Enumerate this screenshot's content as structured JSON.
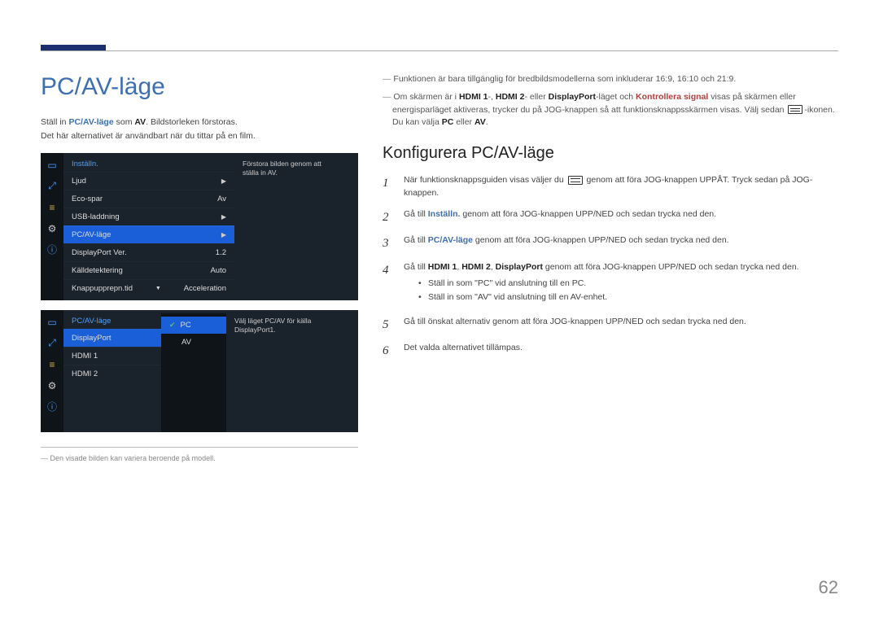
{
  "page_number": "62",
  "left": {
    "title": "PC/AV-läge",
    "para1_pre": "Ställ in ",
    "para1_hl": "PC/AV-läge",
    "para1_mid": " som ",
    "para1_bold": "AV",
    "para1_post": ". Bildstorleken förstoras.",
    "para2": "Det här alternativet är användbart när du tittar på en film.",
    "footnote": "Den visade bilden kan variera beroende på modell."
  },
  "osd1": {
    "title": "Inställn.",
    "rows": [
      {
        "label": "Ljud",
        "value": "",
        "chev": true
      },
      {
        "label": "Eco-spar",
        "value": "Av"
      },
      {
        "label": "USB-laddning",
        "value": "",
        "chev": true
      },
      {
        "label": "PC/AV-läge",
        "value": "",
        "chev": true,
        "selected": true
      },
      {
        "label": "DisplayPort Ver.",
        "value": "1.2"
      },
      {
        "label": "Källdetektering",
        "value": "Auto"
      },
      {
        "label": "Knappupprepn.tid",
        "value": "Acceleration"
      }
    ],
    "desc": "Förstora bilden genom att ställa in AV."
  },
  "osd2": {
    "title": "PC/AV-läge",
    "rows": [
      {
        "label": "DisplayPort",
        "selected": true
      },
      {
        "label": "HDMI 1"
      },
      {
        "label": "HDMI 2"
      }
    ],
    "popup": [
      {
        "label": "PC",
        "selected": true,
        "check": true
      },
      {
        "label": "AV"
      }
    ],
    "desc": "Välj läget PC/AV för källa DisplayPort1."
  },
  "right": {
    "note1": "Funktionen är bara tillgänglig för bredbildsmodellerna som inkluderar 16:9, 16:10 och 21:9.",
    "note2_a": "Om skärmen är i ",
    "note2_h1": "HDMI 1",
    "note2_b": "-, ",
    "note2_h2": "HDMI 2",
    "note2_c": "- eller ",
    "note2_h3": "DisplayPort",
    "note2_d": "-läget och ",
    "note2_red": "Kontrollera signal",
    "note2_e": " visas på skärmen eller energisparläget aktiveras, trycker du på JOG-knappen så att funktionsknappsskärmen visas. Välj sedan ",
    "note2_f": "-ikonen. Du kan välja ",
    "note2_pc": "PC",
    "note2_g": " eller ",
    "note2_av": "AV",
    "note2_h": ".",
    "subtitle": "Konfigurera PC/AV-läge",
    "steps": {
      "s1_a": "När funktionsknappsguiden visas väljer du ",
      "s1_b": " genom att föra JOG-knappen UPPÅT. Tryck sedan på JOG-knappen.",
      "s2_a": "Gå till ",
      "s2_hl": "Inställn.",
      "s2_b": " genom att föra JOG-knappen UPP/NED och sedan trycka ned den.",
      "s3_a": "Gå till ",
      "s3_hl": "PC/AV-läge",
      "s3_b": " genom att föra JOG-knappen UPP/NED och sedan trycka ned den.",
      "s4_a": "Gå till ",
      "s4_h1": "HDMI 1",
      "s4_c1": ", ",
      "s4_h2": "HDMI 2",
      "s4_c2": ", ",
      "s4_h3": "DisplayPort",
      "s4_b": " genom att föra JOG-knappen UPP/NED och sedan trycka ned den.",
      "bullet1": "Ställ in som \"PC\" vid anslutning till en PC.",
      "bullet2": "Ställ in som \"AV\" vid anslutning till en AV-enhet.",
      "s5": "Gå till önskat alternativ genom att föra JOG-knappen UPP/NED och sedan trycka ned den.",
      "s6": "Det valda alternativet tillämpas."
    }
  }
}
